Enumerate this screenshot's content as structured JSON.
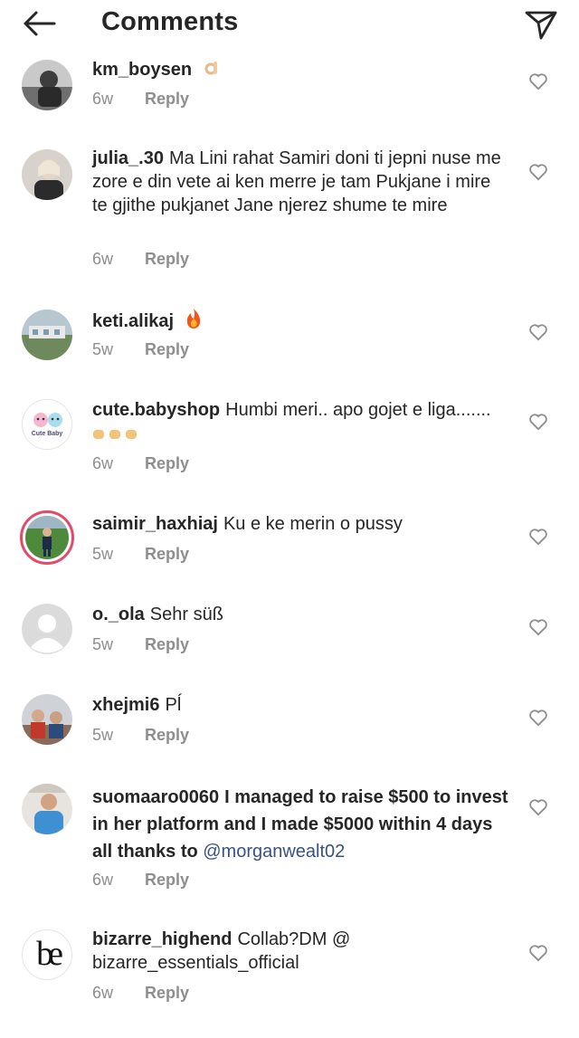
{
  "header": {
    "title": "Comments",
    "back_icon": "arrow-left-icon",
    "share_icon": "paper-plane-icon"
  },
  "comments": [
    {
      "username": "km_boysen",
      "text": "",
      "emoji": "ok-hand",
      "time": "6w",
      "reply": "Reply"
    },
    {
      "username": "julia_.30",
      "text": "Ma Lini rahat Samiri doni ti jepni nuse me zore e din vete ai ken merre je tam Pukjane i mire te gjithe pukjanet Jane njerez shume te mire",
      "time": "6w",
      "reply": "Reply"
    },
    {
      "username": "keti.alikaj",
      "text": "",
      "emoji": "fire",
      "time": "5w",
      "reply": "Reply"
    },
    {
      "username": "cute.babyshop",
      "text": "Humbi meri.. apo gojet e liga.......",
      "emoji": "hands-x3",
      "time": "6w",
      "reply": "Reply",
      "avatar_text": "Cute Baby"
    },
    {
      "username": "saimir_haxhiaj",
      "text": "Ku e ke merin o pussy",
      "time": "5w",
      "reply": "Reply"
    },
    {
      "username": "o._ola",
      "text": "Sehr süß",
      "time": "5w",
      "reply": "Reply"
    },
    {
      "username": "xhejmi6",
      "text": "Pĺ",
      "time": "5w",
      "reply": "Reply"
    },
    {
      "username": "suomaaro0060",
      "text": "I managed to raise $500 to invest in her platform and I made $5000 within 4 days all thanks to ",
      "mention": "@morganwealt02",
      "time": "6w",
      "reply": "Reply"
    },
    {
      "username": "bizarre_highend",
      "text": "Collab?DM @ bizarre_essentials_official",
      "time": "6w",
      "reply": "Reply",
      "avatar_text": "be"
    }
  ],
  "colors": {
    "text": "#262626",
    "muted": "#8e8e8e",
    "mention": "#385185",
    "story_ring": "#e24b6a"
  }
}
